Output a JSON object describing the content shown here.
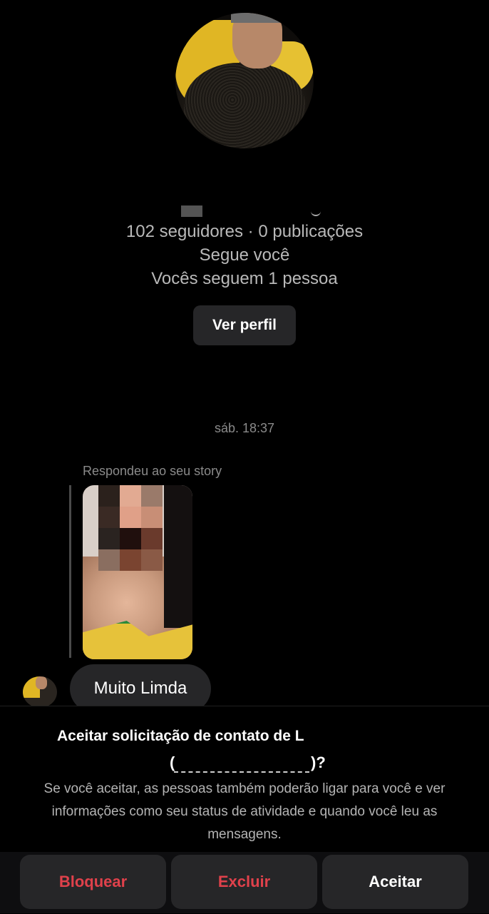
{
  "profile": {
    "stats_line": "102 seguidores · 0 publicações",
    "follows_you": "Segue você",
    "mutual": "Vocês seguem 1 pessoa",
    "view_profile_label": "Ver perfil"
  },
  "thread": {
    "timestamp": "sáb. 18:37",
    "story_reply_caption": "Respondeu ao seu story",
    "message_text": "Muito Limda"
  },
  "request_sheet": {
    "title": "Aceitar solicitação de contato de L",
    "title_line2_start": "(",
    "title_line2_end": ")?",
    "body": "Se você aceitar, as pessoas também poderão ligar para você e ver informações como seu status de atividade e quando você leu as mensagens.",
    "block_label": "Bloquear",
    "delete_label": "Excluir",
    "accept_label": "Aceitar"
  },
  "colors": {
    "background": "#000000",
    "button_bg": "#262628",
    "danger": "#e0414b",
    "muted_text": "#b9b9b9"
  },
  "icons": [
    "profile-avatar",
    "sender-avatar",
    "story-thumbnail"
  ]
}
